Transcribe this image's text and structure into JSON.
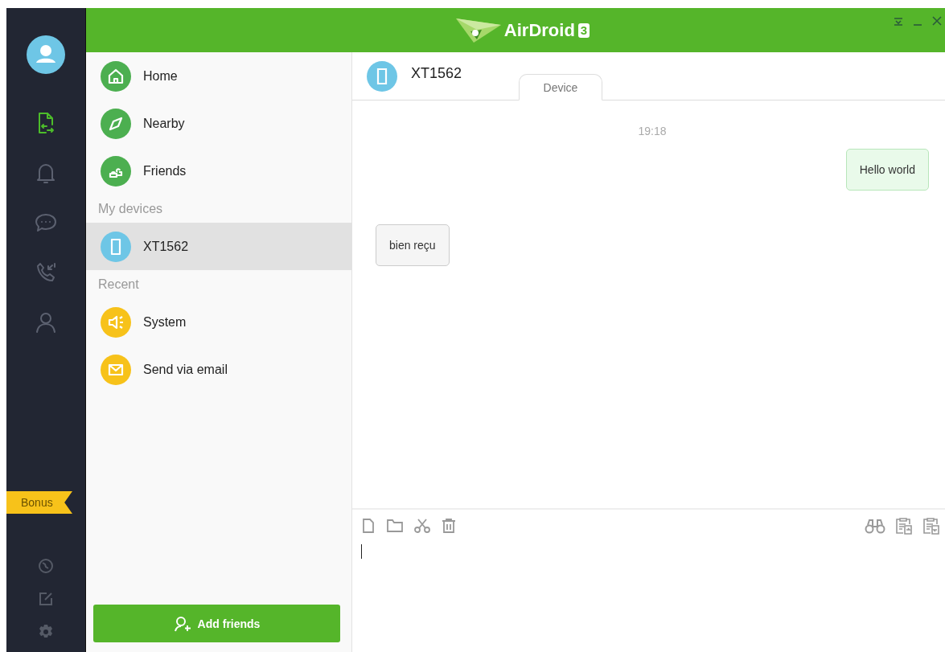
{
  "window": {
    "app_name": "AirDroid",
    "version": "3"
  },
  "nav": [
    {
      "kind": "transfer",
      "selected": true
    },
    {
      "kind": "bell",
      "selected": false
    },
    {
      "kind": "chat",
      "selected": false
    },
    {
      "kind": "phone",
      "selected": false
    },
    {
      "kind": "person",
      "selected": false
    }
  ],
  "bonus": "Bonus",
  "sidebar": {
    "groups": [
      {
        "items": [
          {
            "label": "Home",
            "kind": "home",
            "color": "#4caf50",
            "selected": false
          },
          {
            "label": "Nearby",
            "kind": "compass",
            "color": "#4caf50",
            "selected": false
          },
          {
            "label": "Friends",
            "kind": "friends",
            "color": "#4caf50",
            "selected": false
          }
        ]
      },
      {
        "title": "My devices",
        "items": [
          {
            "label": "XT1562",
            "kind": "tablet",
            "color": "#6ec6e6",
            "selected": true
          }
        ]
      },
      {
        "title": "Recent",
        "items": [
          {
            "label": "System",
            "kind": "speaker",
            "color": "#f7c21a",
            "selected": false
          },
          {
            "label": "Send via email",
            "kind": "mail",
            "color": "#f7c21a",
            "selected": false
          }
        ]
      }
    ],
    "add_button": "Add friends"
  },
  "conversation": {
    "device": "XT1562",
    "tabs": [
      {
        "label": "Device",
        "selected": true
      }
    ],
    "timestamp": "19:18",
    "messages": [
      {
        "kind": "out",
        "text": "Hello world"
      },
      {
        "kind": "in",
        "text": "bien reçu"
      }
    ]
  }
}
